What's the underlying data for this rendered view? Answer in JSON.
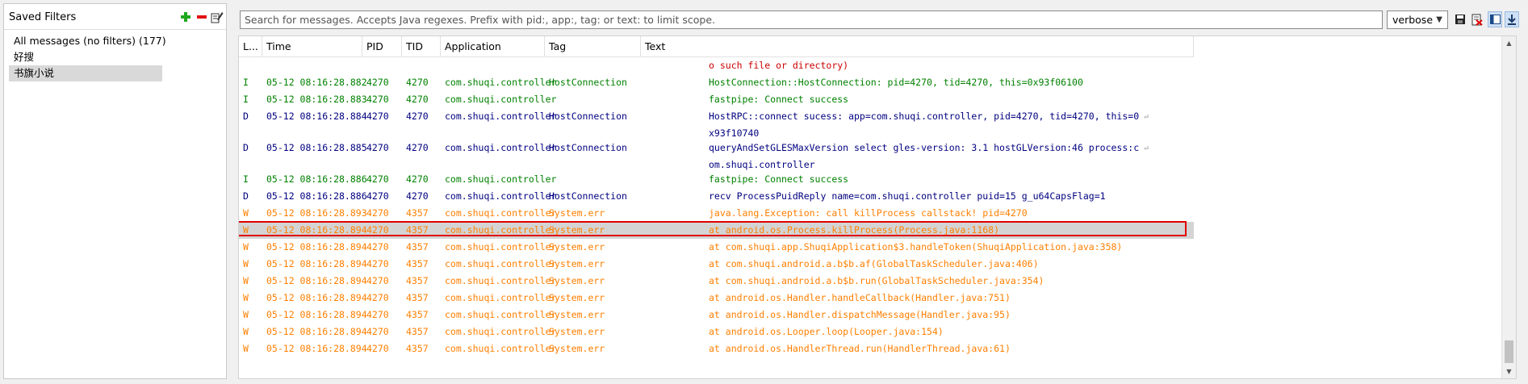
{
  "filters": {
    "title": "Saved Filters",
    "items": [
      {
        "label": "All messages (no filters) (177)",
        "selected": false
      },
      {
        "label": "好搜",
        "selected": false
      },
      {
        "label": "书旗小说",
        "selected": true
      }
    ]
  },
  "search": {
    "placeholder": "Search for messages. Accepts Java regexes. Prefix with pid:, app:, tag: or text: to limit scope.",
    "value": ""
  },
  "log_level": {
    "selected": "verbose"
  },
  "table": {
    "columns": [
      "L...",
      "Time",
      "PID",
      "TID",
      "Application",
      "Tag",
      "Text"
    ],
    "rows": [
      {
        "level": "",
        "time": "",
        "pid": "",
        "tid": "",
        "app": "",
        "tag": "",
        "text": [
          "o such file or directory)"
        ],
        "color": "#cc0000",
        "selected": false
      },
      {
        "level": "I",
        "time": "05-12 08:16:28.882",
        "pid": "4270",
        "tid": "4270",
        "app": "com.shuqi.controller",
        "tag": "HostConnection",
        "text": [
          "HostConnection::HostConnection: pid=4270, tid=4270, this=0x93f06100"
        ],
        "color": "#008000",
        "selected": false
      },
      {
        "level": "I",
        "time": "05-12 08:16:28.883",
        "pid": "4270",
        "tid": "4270",
        "app": "com.shuqi.controller",
        "tag": "",
        "text": [
          "fastpipe: Connect success"
        ],
        "color": "#008000",
        "selected": false
      },
      {
        "level": "D",
        "time": "05-12 08:16:28.884",
        "pid": "4270",
        "tid": "4270",
        "app": "com.shuqi.controller",
        "tag": "HostConnection",
        "text": [
          "HostRPC::connect sucess: app=com.shuqi.controller, pid=4270, tid=4270, this=0",
          "x93f10740"
        ],
        "color": "#000080",
        "selected": false
      },
      {
        "level": "D",
        "time": "05-12 08:16:28.885",
        "pid": "4270",
        "tid": "4270",
        "app": "com.shuqi.controller",
        "tag": "HostConnection",
        "text": [
          "queryAndSetGLESMaxVersion select gles-version: 3.1 hostGLVersion:46 process:c",
          "om.shuqi.controller"
        ],
        "color": "#000080",
        "selected": false
      },
      {
        "level": "I",
        "time": "05-12 08:16:28.886",
        "pid": "4270",
        "tid": "4270",
        "app": "com.shuqi.controller",
        "tag": "",
        "text": [
          "fastpipe: Connect success"
        ],
        "color": "#008000",
        "selected": false
      },
      {
        "level": "D",
        "time": "05-12 08:16:28.886",
        "pid": "4270",
        "tid": "4270",
        "app": "com.shuqi.controller",
        "tag": "HostConnection",
        "text": [
          "recv ProcessPuidReply name=com.shuqi.controller puid=15 g_u64CapsFlag=1"
        ],
        "color": "#000080",
        "selected": false
      },
      {
        "level": "W",
        "time": "05-12 08:16:28.893",
        "pid": "4270",
        "tid": "4357",
        "app": "com.shuqi.controller",
        "tag": "System.err",
        "text": [
          "java.lang.Exception: call killProcess callstack! pid=4270"
        ],
        "color": "#ff7f00",
        "selected": false
      },
      {
        "level": "W",
        "time": "05-12 08:16:28.894",
        "pid": "4270",
        "tid": "4357",
        "app": "com.shuqi.controller",
        "tag": "System.err",
        "text": [
          "at android.os.Process.killProcess(Process.java:1168)"
        ],
        "color": "#ff7f00",
        "selected": true
      },
      {
        "level": "W",
        "time": "05-12 08:16:28.894",
        "pid": "4270",
        "tid": "4357",
        "app": "com.shuqi.controller",
        "tag": "System.err",
        "text": [
          "at com.shuqi.app.ShuqiApplication$3.handleToken(ShuqiApplication.java:358)"
        ],
        "color": "#ff7f00",
        "selected": false
      },
      {
        "level": "W",
        "time": "05-12 08:16:28.894",
        "pid": "4270",
        "tid": "4357",
        "app": "com.shuqi.controller",
        "tag": "System.err",
        "text": [
          "at com.shuqi.android.a.b$b.af(GlobalTaskScheduler.java:406)"
        ],
        "color": "#ff7f00",
        "selected": false
      },
      {
        "level": "W",
        "time": "05-12 08:16:28.894",
        "pid": "4270",
        "tid": "4357",
        "app": "com.shuqi.controller",
        "tag": "System.err",
        "text": [
          "at com.shuqi.android.a.b$b.run(GlobalTaskScheduler.java:354)"
        ],
        "color": "#ff7f00",
        "selected": false
      },
      {
        "level": "W",
        "time": "05-12 08:16:28.894",
        "pid": "4270",
        "tid": "4357",
        "app": "com.shuqi.controller",
        "tag": "System.err",
        "text": [
          "at android.os.Handler.handleCallback(Handler.java:751)"
        ],
        "color": "#ff7f00",
        "selected": false
      },
      {
        "level": "W",
        "time": "05-12 08:16:28.894",
        "pid": "4270",
        "tid": "4357",
        "app": "com.shuqi.controller",
        "tag": "System.err",
        "text": [
          "at android.os.Handler.dispatchMessage(Handler.java:95)"
        ],
        "color": "#ff7f00",
        "selected": false
      },
      {
        "level": "W",
        "time": "05-12 08:16:28.894",
        "pid": "4270",
        "tid": "4357",
        "app": "com.shuqi.controller",
        "tag": "System.err",
        "text": [
          "at android.os.Looper.loop(Looper.java:154)"
        ],
        "color": "#ff7f00",
        "selected": false
      },
      {
        "level": "W",
        "time": "05-12 08:16:28.894",
        "pid": "4270",
        "tid": "4357",
        "app": "com.shuqi.controller",
        "tag": "System.err",
        "text": [
          "at android.os.HandlerThread.run(HandlerThread.java:61)"
        ],
        "color": "#ff7f00",
        "selected": false
      }
    ]
  },
  "icons": {
    "add_filter": "plus-icon",
    "remove_filter": "minus-icon",
    "edit_filter": "edit-icon",
    "save_log": "save-icon",
    "clear_log": "clear-log-icon",
    "toggle_filters": "panel-toggle-icon",
    "scroll_lock": "scroll-to-end-icon",
    "wrap": "wrap-arrow-icon"
  },
  "colors": {
    "info": "#008000",
    "debug": "#000080",
    "warn": "#ff7f00",
    "error": "#cc0000",
    "highlight": "#e00000",
    "selection": "#d4d4d4"
  }
}
